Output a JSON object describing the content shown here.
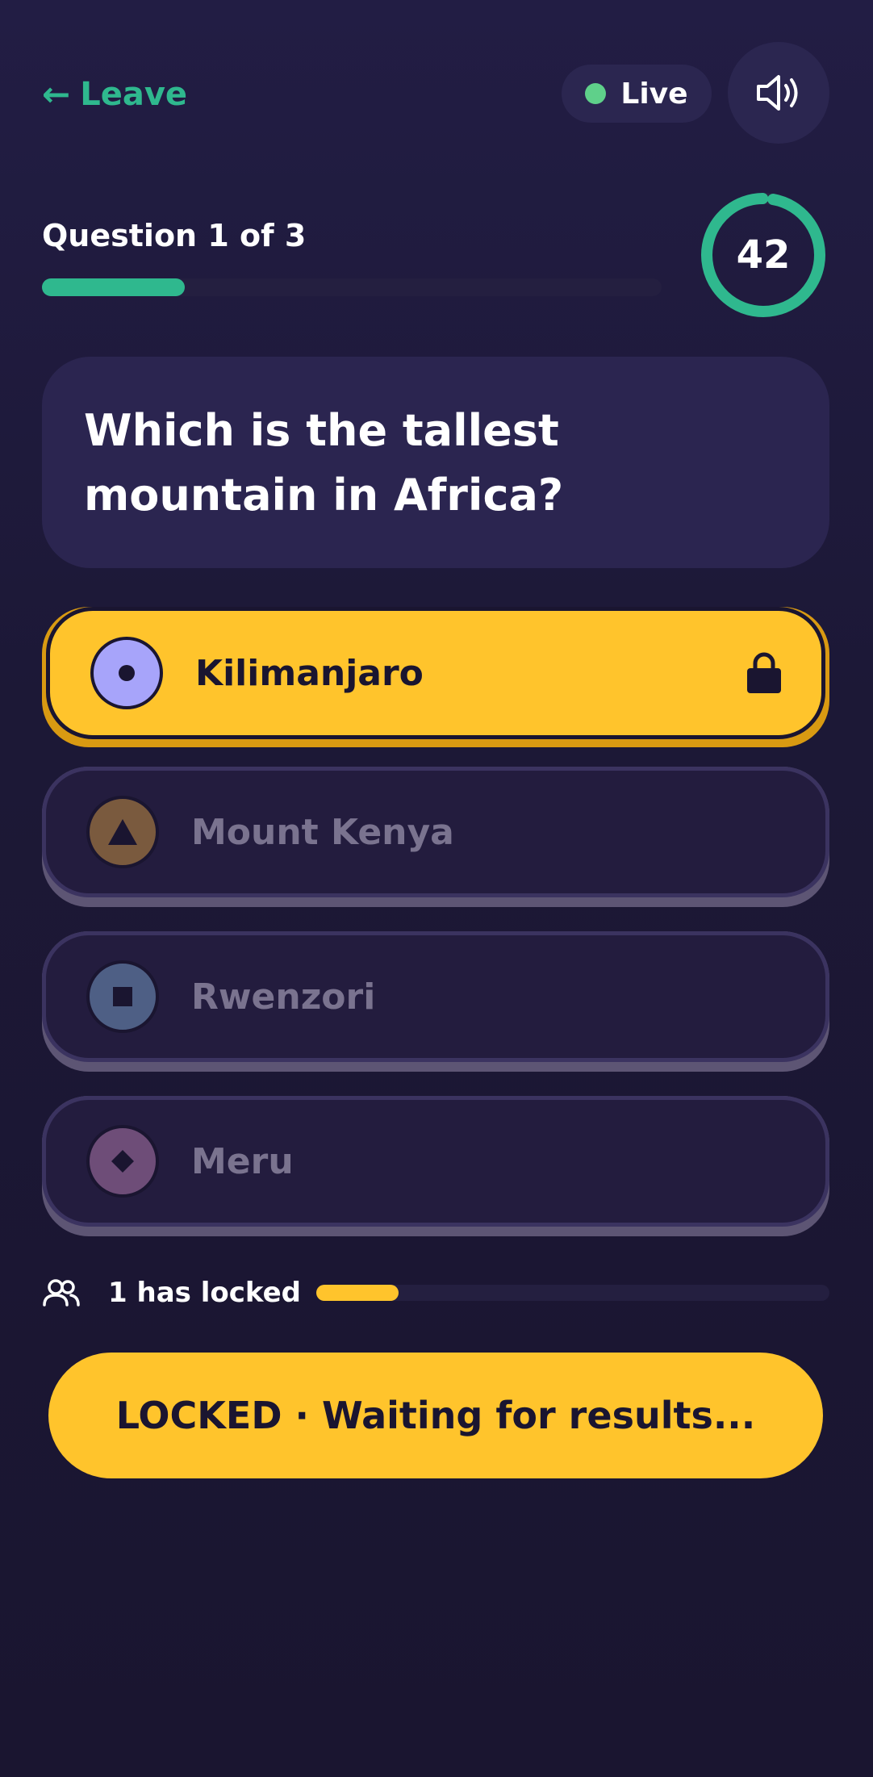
{
  "header": {
    "leave_arrow": "←",
    "leave_label": "Leave",
    "live_label": "Live",
    "sound_icon": "speaker-volume-icon"
  },
  "question": {
    "counter": "Question 1 of 3",
    "progress": 0.23,
    "timer": "42",
    "timer_fraction": 0.97,
    "text": "Which is the tallest mountain in Africa?"
  },
  "answers": [
    {
      "label": "Kilimanjaro",
      "shape": "circle",
      "selected": true,
      "badge_color": "#a7a4fa"
    },
    {
      "label": "Mount Kenya",
      "shape": "triangle",
      "selected": false,
      "badge_color": "#7a5a3e"
    },
    {
      "label": "Rwenzori",
      "shape": "square",
      "selected": false,
      "badge_color": "#4e5f85"
    },
    {
      "label": "Meru",
      "shape": "diamond",
      "selected": false,
      "badge_color": "#6e4d78"
    }
  ],
  "locked": {
    "text": "1 has locked",
    "fraction": 0.16
  },
  "status": {
    "label": "LOCKED · Waiting for results..."
  },
  "colors": {
    "accent_green": "#2fb88e",
    "accent_yellow": "#ffc42c",
    "live_dot": "#5fd08a",
    "background": "#1c1836"
  }
}
